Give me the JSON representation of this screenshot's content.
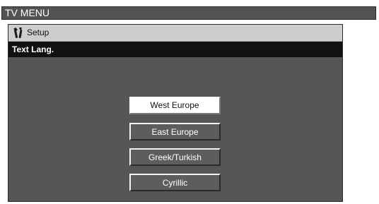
{
  "menu": {
    "title": "TV MENU"
  },
  "breadcrumb": {
    "icon": "wrench-screwdriver-icon",
    "label": "Setup"
  },
  "section": {
    "title": "Text Lang."
  },
  "options": [
    {
      "label": "West Europe",
      "selected": true
    },
    {
      "label": "East Europe",
      "selected": false
    },
    {
      "label": "Greek/Turkish",
      "selected": false
    },
    {
      "label": "Cyrillic",
      "selected": false
    }
  ]
}
